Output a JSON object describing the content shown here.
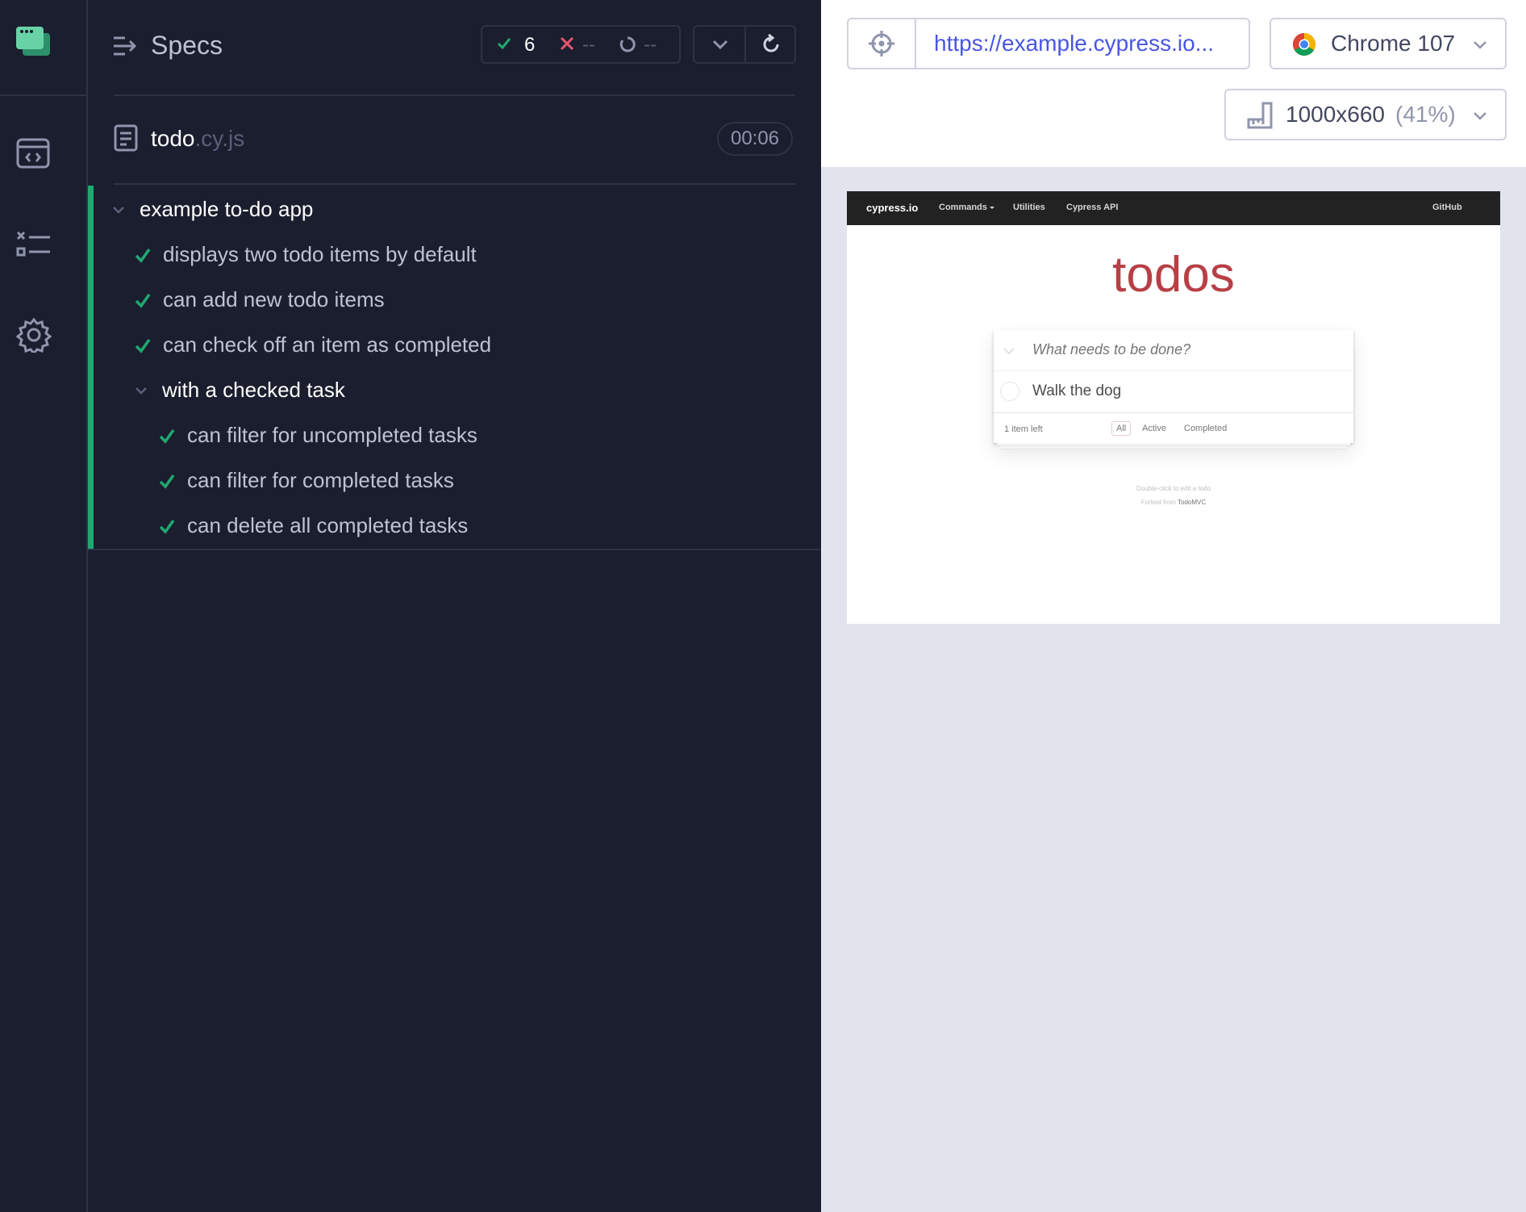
{
  "nav": {
    "items": [
      "logo",
      "specs",
      "runs",
      "settings"
    ]
  },
  "reporter": {
    "header_title": "Specs",
    "stats": {
      "passed": "6",
      "failed": "--",
      "pending": "--"
    },
    "spec": {
      "name": "todo",
      "ext": ".cy.js",
      "duration": "00:06"
    },
    "suite": "example to-do app",
    "tests": [
      "displays two todo items by default",
      "can add new todo items",
      "can check off an item as completed"
    ],
    "nested_suite": "with a checked task",
    "nested_tests": [
      "can filter for uncompleted tasks",
      "can filter for completed tasks",
      "can delete all completed tasks"
    ]
  },
  "toolbar": {
    "url": "https://example.cypress.io...",
    "browser": "Chrome 107",
    "viewport": "1000x660",
    "viewport_scale": "(41%)"
  },
  "aut": {
    "brand": "cypress.io",
    "nav_commands": "Commands",
    "nav_utilities": "Utilities",
    "nav_api": "Cypress API",
    "nav_github": "GitHub",
    "title": "todos",
    "input_placeholder": "What needs to be done?",
    "todo_item": "Walk the dog",
    "items_left": "1 item left",
    "filters": [
      "All",
      "Active",
      "Completed"
    ],
    "info_line1": "Double-click to edit a todo",
    "info_forked": "Forked from ",
    "info_link": "TodoMVC"
  },
  "colors": {
    "pass": "#1fa971",
    "fail": "#e45770",
    "url": "#4956e3",
    "todos_title": "#b83f45"
  }
}
